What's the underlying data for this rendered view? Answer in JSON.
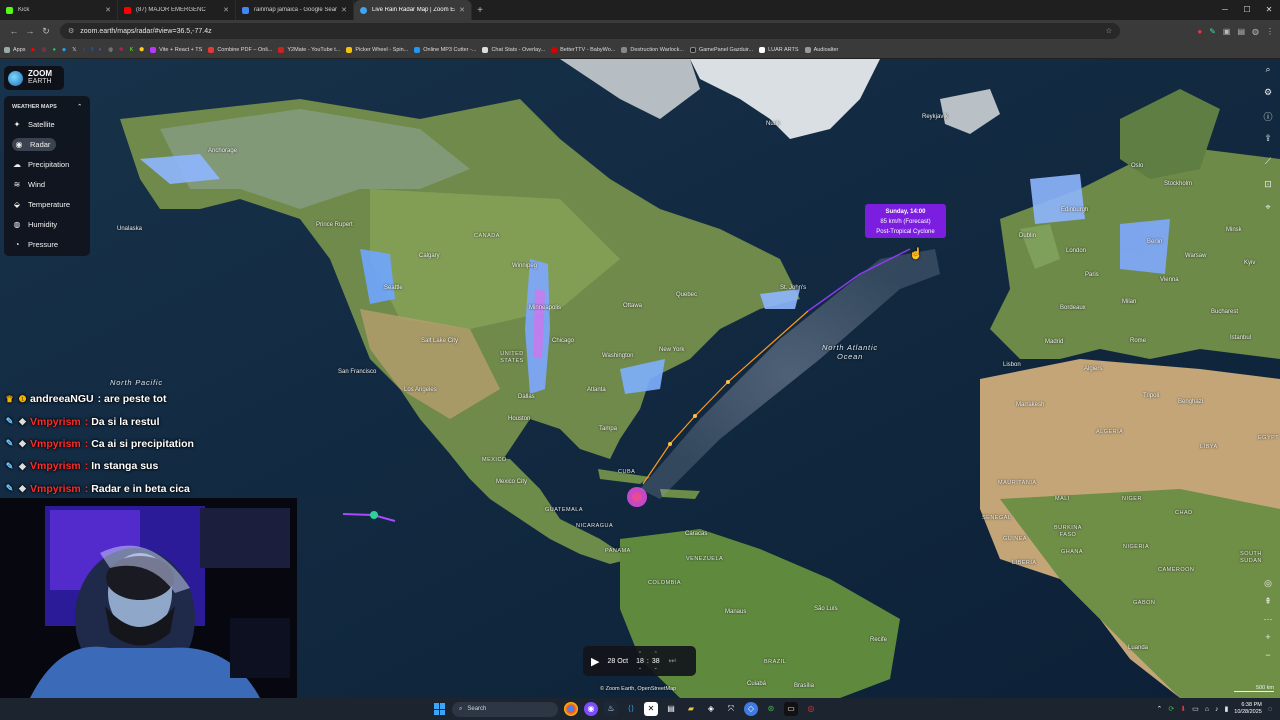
{
  "browser": {
    "tabs": [
      {
        "label": "Kick",
        "color": "#53fc18",
        "active": false
      },
      {
        "label": "(87) MAJOR EMERGENC",
        "color": "#ff0000",
        "active": false
      },
      {
        "label": "rainmap jamaica - Google Sear",
        "color": "#4285f4",
        "active": false
      },
      {
        "label": "Live Rain Radar Map | Zoom Ea",
        "color": "#3aa6f5",
        "active": true
      }
    ],
    "new_tab": "+",
    "url": "zoom.earth/maps/radar/#view=36.5,-77.4z",
    "bookmarks": [
      {
        "label": "Apps",
        "color": "#9aa"
      },
      {
        "label": "Vite + React + TS",
        "color": "#bd34fe"
      },
      {
        "label": "Combine PDF – Onli...",
        "color": "#e53935"
      },
      {
        "label": "Y2Mate - YouTube t...",
        "color": "#cc2222"
      },
      {
        "label": "Picker Wheel - Spin...",
        "color": "#f4c20d"
      },
      {
        "label": "Online MP3 Cutter -...",
        "color": "#2196f3"
      },
      {
        "label": "Chat Stats - Overlay...",
        "color": "#ddd"
      },
      {
        "label": "BetterTTV - BabyWo...",
        "color": "#d50000"
      },
      {
        "label": "Destruction Warlock...",
        "color": "#888"
      },
      {
        "label": "GamePanel Gazduir...",
        "color": "#222"
      },
      {
        "label": "LUAR ARTS",
        "color": "#fff"
      },
      {
        "label": "Audioalter",
        "color": "#999"
      }
    ]
  },
  "logo": {
    "line1": "ZOOM",
    "line2": "EARTH"
  },
  "menu": {
    "header": "WEATHER MAPS",
    "items": [
      {
        "label": "Satellite",
        "icon": "satellite-icon",
        "glyph": "✦"
      },
      {
        "label": "Radar",
        "icon": "radar-icon",
        "glyph": "◉",
        "active": true
      },
      {
        "label": "Precipitation",
        "icon": "cloud-icon",
        "glyph": "☁"
      },
      {
        "label": "Wind",
        "icon": "wind-icon",
        "glyph": "≋"
      },
      {
        "label": "Temperature",
        "icon": "thermometer-icon",
        "glyph": "⬙"
      },
      {
        "label": "Humidity",
        "icon": "droplet-icon",
        "glyph": "💧"
      },
      {
        "label": "Pressure",
        "icon": "gauge-icon",
        "glyph": "◔"
      }
    ]
  },
  "storm": {
    "date": "Sunday, 14:00",
    "wind": "85 km/h (Forecast)",
    "type": "Post-Tropical Cyclone"
  },
  "map_labels": {
    "cities": [
      "Anchorage",
      "Unalaska",
      "Prince Rupert",
      "Calgary",
      "Seattle",
      "Winnipeg",
      "Minneapolis",
      "Ottawa",
      "Quebec",
      "St. John's",
      "Chicago",
      "Salt Lake City",
      "San Francisco",
      "Los Angeles",
      "Washington",
      "New York",
      "Dallas",
      "Atlanta",
      "Houston",
      "Tampa",
      "Mexico City",
      "Caracas",
      "Manaus",
      "São Luís",
      "Recife",
      "Cuiabá",
      "Brasília",
      "Nuuk",
      "Reykjavík",
      "Oslo",
      "Stockholm",
      "Edinburgh",
      "Dublin",
      "London",
      "Paris",
      "Berlin",
      "Warsaw",
      "Minsk",
      "Kyiv",
      "Vienna",
      "Milan",
      "Bordeaux",
      "Madrid",
      "Rome",
      "Bucharest",
      "Istanbul",
      "Lisbon",
      "Algiers",
      "Tripoli",
      "Benghazi",
      "Marrakesh",
      "Luanda"
    ],
    "countries": [
      "CANADA",
      "UNITED STATES",
      "MEXICO",
      "CUBA",
      "GUATEMALA",
      "NICARAGUA",
      "PANAMA",
      "VENEZUELA",
      "COLOMBIA",
      "BRAZIL",
      "ALGERIA",
      "LIBYA",
      "EGYPT",
      "MAURITANIA",
      "MALI",
      "NIGER",
      "CHAD",
      "SENEGAL",
      "GUINEA",
      "BURKINA FASO",
      "GHANA",
      "NIGERIA",
      "LIBERIA",
      "CAMEROON",
      "GABON",
      "SOUTH SUDAN"
    ],
    "ocean_1": "North Atlantic",
    "ocean_2": "Ocean",
    "ocean_3": "North Pacific"
  },
  "chat": [
    {
      "user": "andreeaNGU",
      "sep": ":",
      "msg": "are peste tot",
      "color": "#ffffff",
      "badge": "👑"
    },
    {
      "user": "Vmpyrism",
      "sep": ":",
      "msg": "Da si la restul",
      "color": "#ff2a2a",
      "badge": "✈"
    },
    {
      "user": "Vmpyrism",
      "sep": ":",
      "msg": "Ca ai si precipitation",
      "color": "#ff2a2a",
      "badge": "✈"
    },
    {
      "user": "Vmpyrism",
      "sep": ":",
      "msg": "In stanga sus",
      "color": "#ff2a2a",
      "badge": "✈"
    },
    {
      "user": "Vmpyrism",
      "sep": ":",
      "msg": "Radar e in beta cica",
      "color": "#ff2a2a",
      "badge": "✈"
    }
  ],
  "timeline": {
    "date": "28 Oct",
    "hour": "18",
    "minute": "38"
  },
  "credit": "© Zoom Earth, OpenStreetMap",
  "scale": "500 km",
  "taskbar": {
    "search_placeholder": "Search",
    "time": "6:38 PM",
    "date": "10/28/2025"
  }
}
